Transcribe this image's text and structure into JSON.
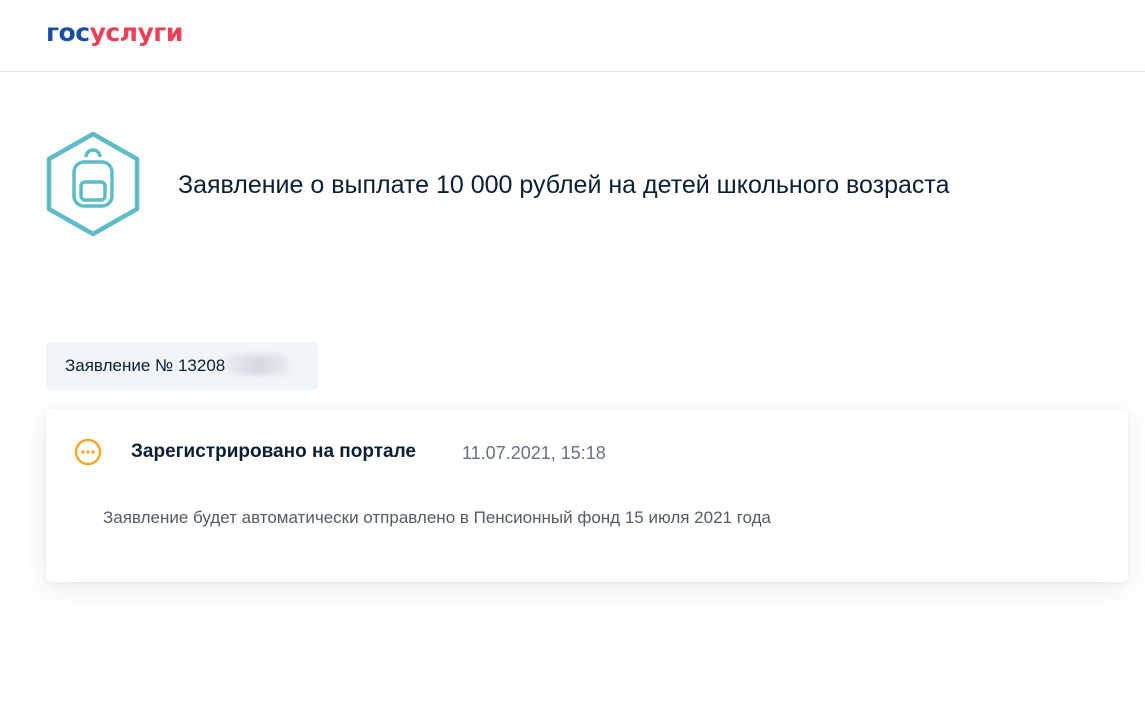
{
  "header": {
    "logo_part1": "гос",
    "logo_part2": "услуги"
  },
  "service": {
    "icon": "backpack-icon",
    "title": "Заявление о выплате 10 000 рублей на детей школьного возраста"
  },
  "application": {
    "number_label": "Заявление № 13208"
  },
  "status": {
    "icon": "in-progress-dots-icon",
    "label": "Зарегистрировано на портале",
    "datetime": "11.07.2021, 15:18",
    "message": "Заявление будет автоматически отправлено в Пенсионный фонд 15 июля 2021 года"
  },
  "colors": {
    "brand_blue": "#1a4fa0",
    "brand_red": "#ee3f58",
    "icon_teal": "#5dbcc8",
    "status_orange": "#f5a623"
  }
}
